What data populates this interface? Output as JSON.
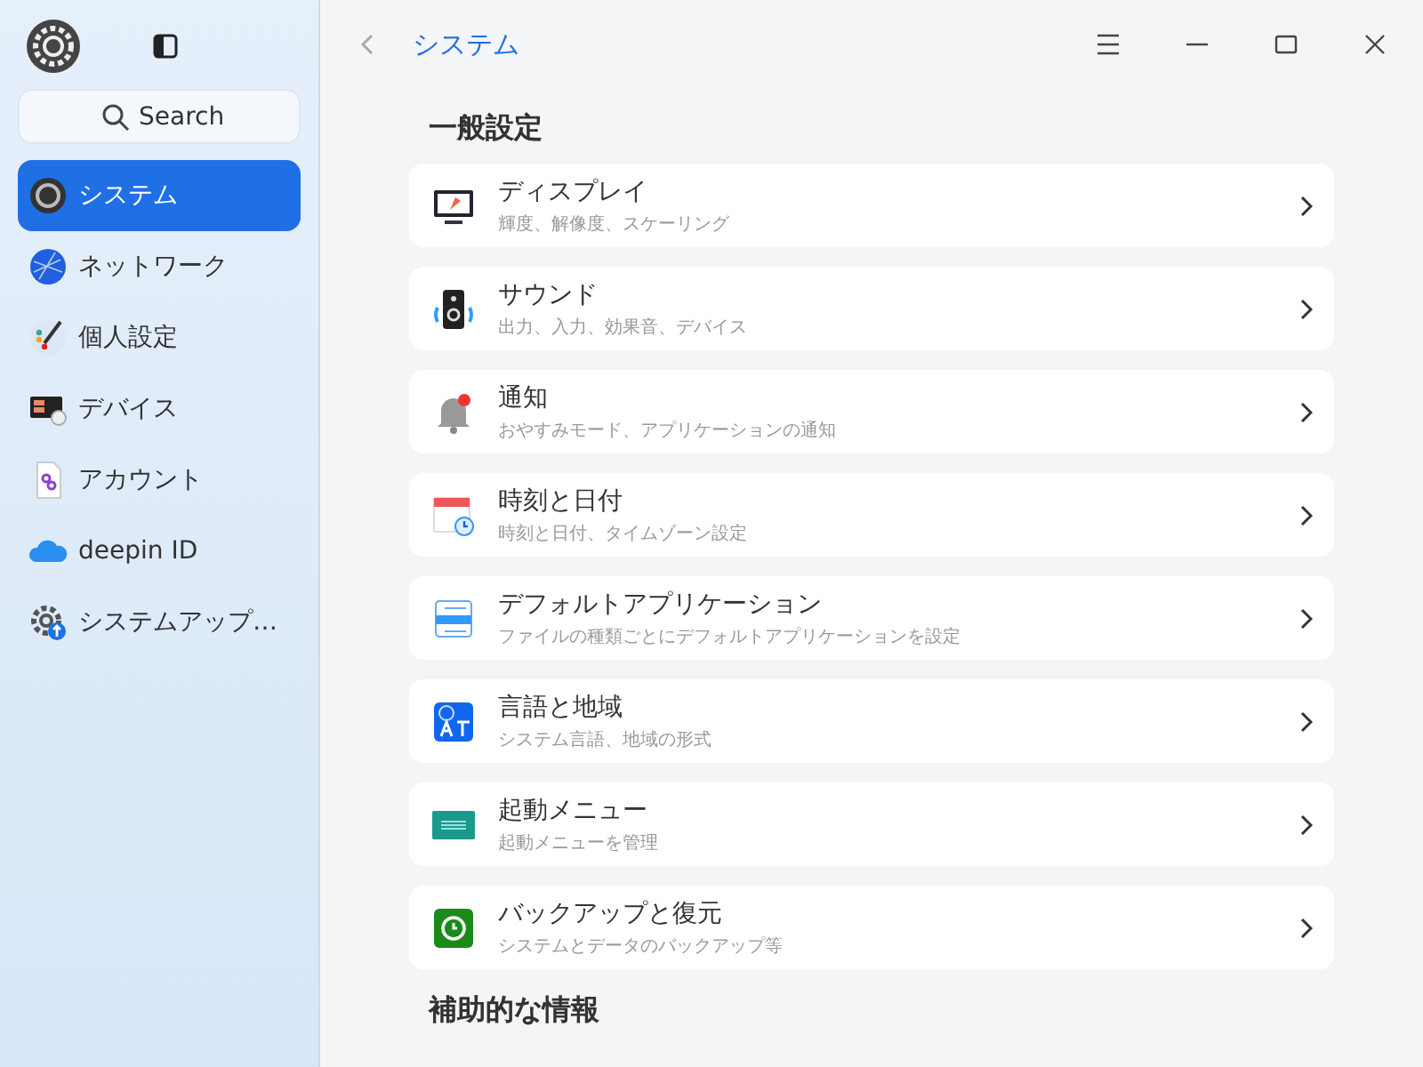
{
  "sidebar": {
    "search": {
      "placeholder": "Search"
    },
    "items": [
      {
        "label": "システム",
        "selected": true
      },
      {
        "label": "ネットワーク",
        "selected": false
      },
      {
        "label": "個人設定",
        "selected": false
      },
      {
        "label": "デバイス",
        "selected": false
      },
      {
        "label": "アカウント",
        "selected": false
      },
      {
        "label": "deepin ID",
        "selected": false
      },
      {
        "label": "システムアップ…",
        "selected": false
      }
    ]
  },
  "header": {
    "title": "システム"
  },
  "sections": [
    {
      "title": "一般設定",
      "items": [
        {
          "title": "ディスプレイ",
          "subtitle": "輝度、解像度、スケーリング"
        },
        {
          "title": "サウンド",
          "subtitle": "出力、入力、効果音、デバイス"
        },
        {
          "title": "通知",
          "subtitle": "おやすみモード、アプリケーションの通知"
        },
        {
          "title": "時刻と日付",
          "subtitle": "時刻と日付、タイムゾーン設定"
        },
        {
          "title": "デフォルトアプリケーション",
          "subtitle": "ファイルの種類ごとにデフォルトアプリケーションを設定"
        },
        {
          "title": "言語と地域",
          "subtitle": "システム言語、地域の形式"
        },
        {
          "title": "起動メニュー",
          "subtitle": "起動メニューを管理"
        },
        {
          "title": "バックアップと復元",
          "subtitle": "システムとデータのバックアップ等"
        }
      ]
    },
    {
      "title": "補助的な情報"
    }
  ]
}
